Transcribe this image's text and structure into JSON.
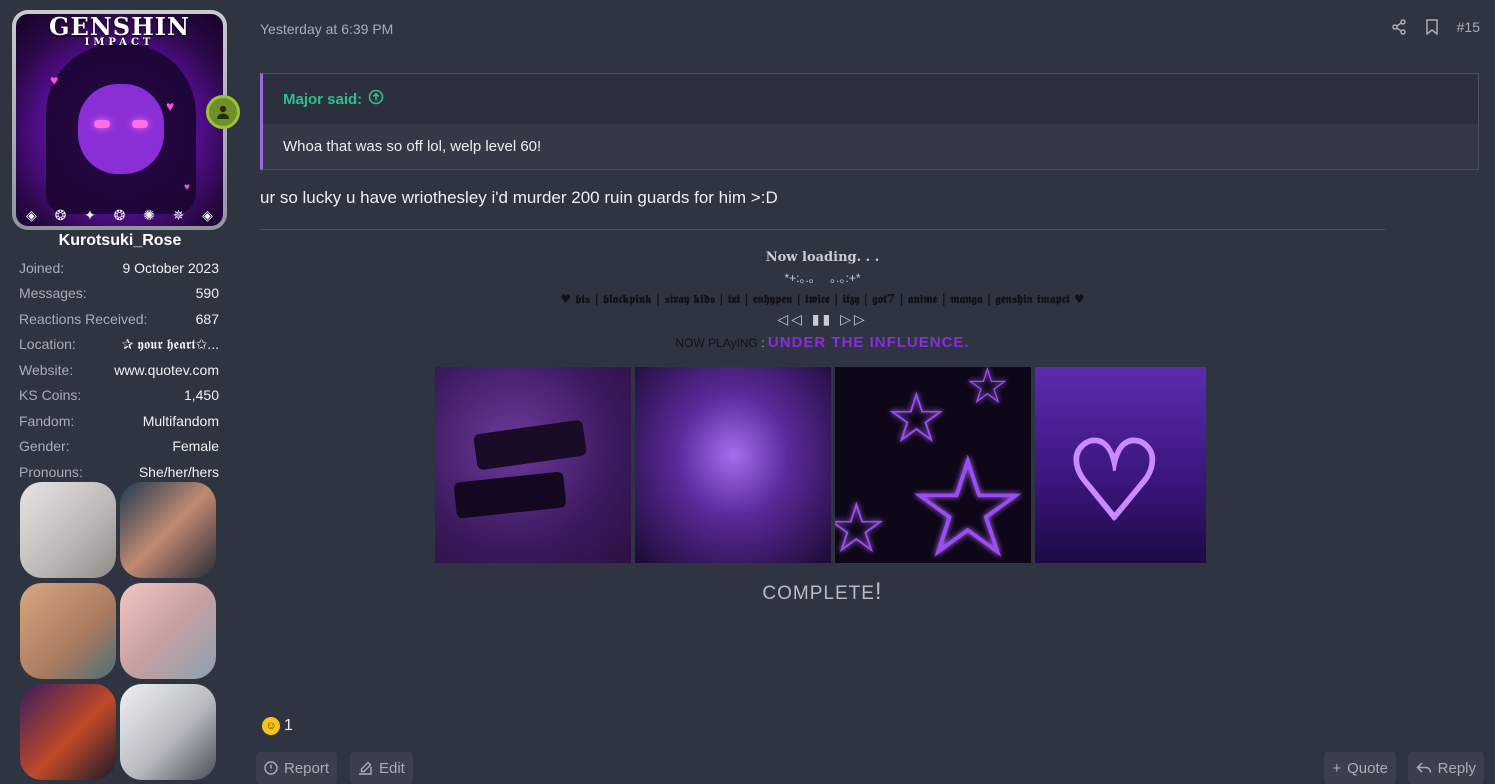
{
  "user": {
    "game_logo": "GENSHIN",
    "game_logo_sub": "IMPACT",
    "username": "Kurotsuki_Rose",
    "info": [
      {
        "key": "Joined:",
        "value": "9 October 2023"
      },
      {
        "key": "Messages:",
        "value": "590"
      },
      {
        "key": "Reactions Received:",
        "value": "687"
      },
      {
        "key": "Location:",
        "value": "✰ 𝖞𝖔𝖚𝖗 𝖍𝖊𝖆𝖗𝖙✩..."
      },
      {
        "key": "Website:",
        "value": "www.quotev.com"
      },
      {
        "key": "KS Coins:",
        "value": "1,450"
      },
      {
        "key": "Fandom:",
        "value": "Multifandom"
      },
      {
        "key": "Gender:",
        "value": "Female"
      },
      {
        "key": "Pronouns:",
        "value": "She/her/hers"
      }
    ]
  },
  "post": {
    "timestamp": "Yesterday at 6:39 PM",
    "number": "#15",
    "quote_author": "Major said:",
    "quote_text": "Whoa that was so off lol, welp level 60!",
    "body": "ur so lucky u have wriothesley i'd murder 200 ruin guards for him >:D",
    "reaction_count": "1",
    "reaction_emoji": "rofl-emoji"
  },
  "signature": {
    "loading": "Now loading. . .",
    "sparkle": "*+:｡.｡　 ｡.｡:+*",
    "fandoms": "♥ 𝖇𝖙𝖘 | 𝖇𝖑𝖆𝖈𝖐𝖕𝖎𝖓𝖐 | 𝖘𝖙𝖗𝖆𝖞 𝖐𝖎𝖉𝖘 | 𝖙𝖝𝖙 | 𝖊𝖓𝖍𝖞𝖕𝖊𝖓 | 𝖙𝖜𝖎𝖈𝖊 | 𝖎𝖙𝖟𝖞 | 𝖌𝖔𝖙7 | 𝖆𝖓𝖎𝖒𝖊 | 𝖒𝖆𝖓𝖌𝖆 | 𝖌𝖊𝖓𝖘𝖍𝖎𝖓 𝖎𝖒𝖆𝖕𝖈𝖙 ♥",
    "controls": "◁◁ ▮▮ ▷▷",
    "now_playing": "NOW PLAyING",
    "song": "UNDER THE INFLUENCE.",
    "complete": "COMPLETE",
    "complete_bang": "!"
  },
  "actions": {
    "report": "Report",
    "edit": "Edit",
    "quote": "Quote",
    "reply": "Reply"
  },
  "colors": {
    "background": "#2f3441",
    "quote_author": "#2fbf8f",
    "quote_border": "#a06adf",
    "song": "#8b2be2"
  }
}
